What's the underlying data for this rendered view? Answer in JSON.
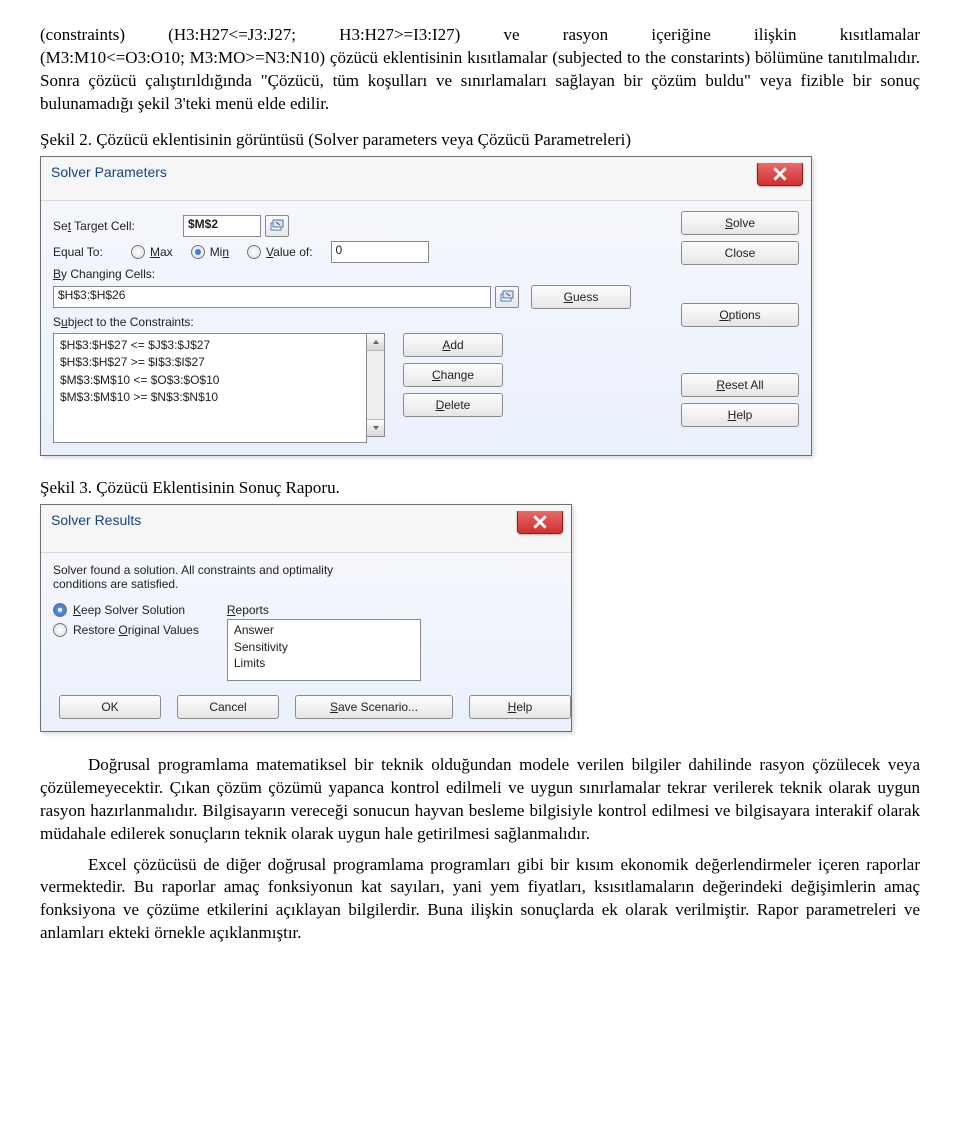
{
  "para_intro_a": "(constraints)  (H3:H27<=J3:J27;  H3:H27>=I3:I27)  ve  rasyon  içeriğine  ilişkin  kısıtlamalar",
  "para_intro_b": "(M3:M10<=O3:O10; M3:MO>=N3:N10) çözücü eklentisinin kısıtlamalar (subjected to the constarints) bölümüne tanıtılmalıdır. Sonra çözücü çalıştırıldığında \"Çözücü, tüm koşulları ve sınırlamaları sağlayan bir çözüm buldu\" veya  fizible bir sonuç bulunamadığı şekil 3'teki menü  elde edilir.",
  "figcap1": "Şekil 2. Çözücü eklentisinin görüntüsü (Solver parameters veya Çözücü Parametreleri)",
  "figcap2": "Şekil 3. Çözücü Eklentisinin Sonuç Raporu.",
  "dlg1": {
    "title": "Solver Parameters",
    "labels": {
      "set_target": "Set Target Cell:",
      "equal_to": "Equal To:",
      "max": "Max",
      "min": "Min",
      "valueof": "Value of:",
      "bycells": "By Changing Cells:",
      "subject": "Subject to the Constraints:"
    },
    "target_value": "$M$2",
    "valueof_input": "0",
    "cells_input": "$H$3:$H$26",
    "constraints": [
      "$H$3:$H$27 <= $J$3:$J$27",
      "$H$3:$H$27 >= $I$3:$I$27",
      "$M$3:$M$10 <= $O$3:$O$10",
      "$M$3:$M$10 >= $N$3:$N$10"
    ],
    "buttons": {
      "solve": "Solve",
      "close": "Close",
      "guess": "Guess",
      "options": "Options",
      "add": "Add",
      "change": "Change",
      "delete": "Delete",
      "reset": "Reset All",
      "help": "Help"
    }
  },
  "dlg2": {
    "title": "Solver Results",
    "msg1": "Solver found a solution.  All constraints and optimality",
    "msg2": "conditions are satisfied.",
    "opt_keep": "Keep Solver Solution",
    "opt_restore": "Restore Original Values",
    "reports_label": "Reports",
    "reports": [
      "Answer",
      "Sensitivity",
      "Limits"
    ],
    "buttons": {
      "ok": "OK",
      "cancel": "Cancel",
      "save": "Save Scenario...",
      "help": "Help"
    }
  },
  "para_end_1": "Doğrusal programlama matematiksel bir teknik olduğundan modele verilen bilgiler dahilinde rasyon çözülecek veya çözülemeyecektir. Çıkan çözüm çözümü yapanca kontrol edilmeli ve uygun sınırlamalar tekrar verilerek teknik olarak uygun rasyon hazırlanmalıdır. Bilgisayarın vereceği sonucun hayvan besleme bilgisiyle kontrol edilmesi ve bilgisayara interakif olarak müdahale edilerek sonuçların teknik olarak uygun hale getirilmesi sağlanmalıdır.",
  "para_end_2": "Excel çözücüsü de diğer doğrusal programlama programları gibi bir kısım ekonomik değerlendirmeler içeren raporlar vermektedir. Bu raporlar amaç fonksiyonun kat sayıları, yani yem fiyatları, ksısıtlamaların değerindeki değişimlerin amaç fonksiyona ve çözüme etkilerini açıklayan bilgilerdir. Buna ilişkin sonuçlarda ek  olarak verilmiştir. Rapor parametreleri ve anlamları ekteki örnekle açıklanmıştır."
}
